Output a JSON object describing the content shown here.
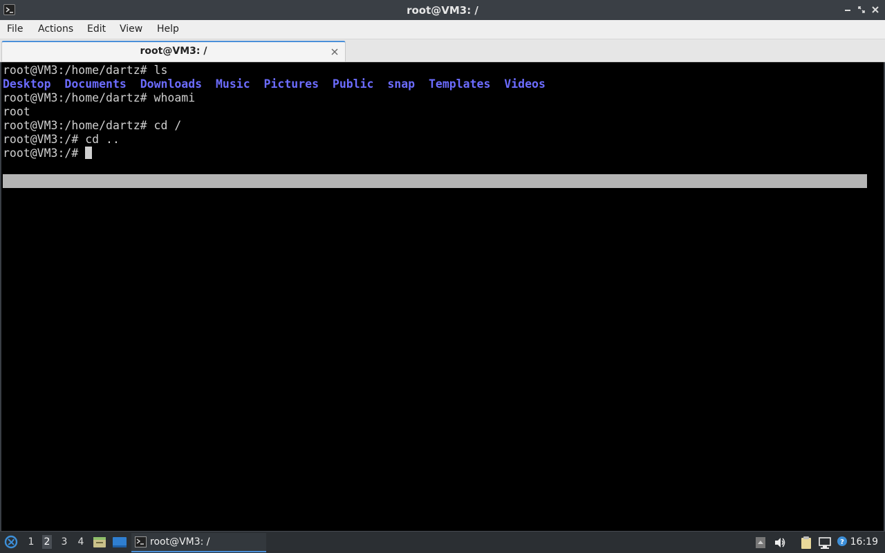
{
  "window": {
    "title": "root@VM3: /"
  },
  "menubar": {
    "items": [
      "File",
      "Actions",
      "Edit",
      "View",
      "Help"
    ]
  },
  "tab": {
    "label": "root@VM3: /"
  },
  "terminal": {
    "lines": [
      {
        "prompt": "root@VM3:/home/dartz# ",
        "cmd": "ls"
      },
      {
        "dirs": [
          "Desktop",
          "Documents",
          "Downloads",
          "Music",
          "Pictures",
          "Public",
          "snap",
          "Templates",
          "Videos"
        ]
      },
      {
        "prompt": "root@VM3:/home/dartz# ",
        "cmd": "whoami"
      },
      {
        "output": "root"
      },
      {
        "prompt": "root@VM3:/home/dartz# ",
        "cmd": "cd /"
      },
      {
        "prompt": "root@VM3:/# ",
        "cmd": "cd .."
      },
      {
        "prompt": "root@VM3:/# ",
        "cmd": ""
      }
    ],
    "dir_color": "#6c6cff"
  },
  "taskbar": {
    "workspaces": [
      "1",
      "2",
      "3",
      "4"
    ],
    "active_workspace": "2",
    "task_label": "root@VM3: /",
    "clock": "16:19"
  },
  "colors": {
    "titlebar": "#3a3f45",
    "accent": "#4a90d9",
    "taskbar": "#2b2f33"
  }
}
